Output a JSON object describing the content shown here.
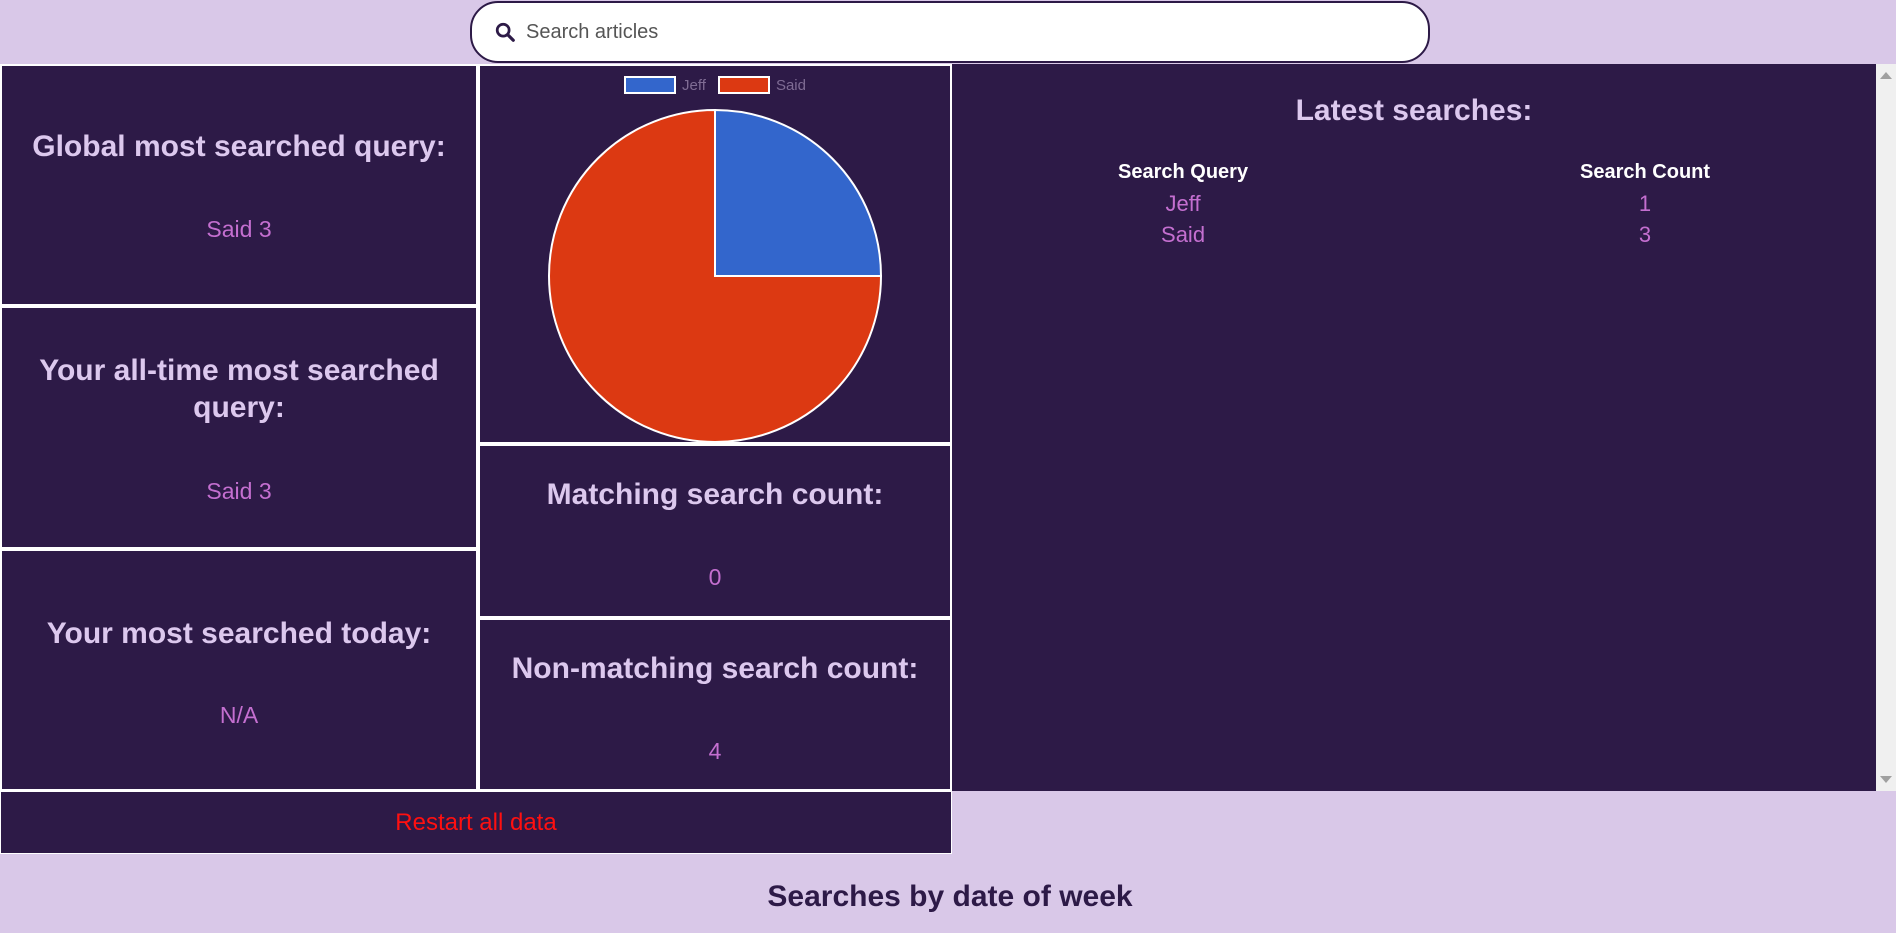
{
  "search": {
    "placeholder": "Search articles"
  },
  "cards": {
    "global_most_searched": {
      "title": "Global most searched query:",
      "value": "Said 3"
    },
    "all_time_most_searched": {
      "title": "Your all-time most searched query:",
      "value": "Said 3"
    },
    "today_most_searched": {
      "title": "Your most searched today:",
      "value": "N/A"
    },
    "matching_count": {
      "title": "Matching search count:",
      "value": "0"
    },
    "non_matching_count": {
      "title": "Non-matching search count:",
      "value": "4"
    }
  },
  "latest": {
    "title": "Latest searches:",
    "headers": [
      "Search Query",
      "Search Count"
    ],
    "rows": [
      {
        "query": "Jeff",
        "count": "1"
      },
      {
        "query": "Said",
        "count": "3"
      }
    ]
  },
  "restart_label": "Restart all data",
  "bottom_title": "Searches by date of week",
  "chart_data": {
    "type": "pie",
    "categories": [
      "Jeff",
      "Said"
    ],
    "values": [
      1,
      3
    ],
    "colors": [
      "#3366cc",
      "#dc3912"
    ],
    "legend": "top"
  }
}
